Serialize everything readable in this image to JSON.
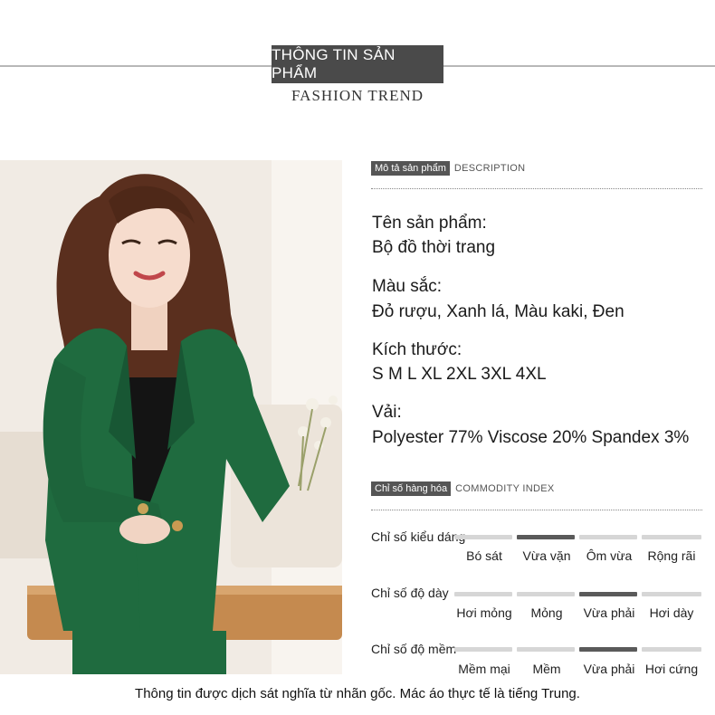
{
  "header": {
    "title": "THÔNG TIN SẢN PHẨM",
    "subtitle": "FASHION TREND"
  },
  "description": {
    "tag": "Mô tả sản phẩm",
    "tag_en": "DESCRIPTION",
    "items": [
      {
        "label": "Tên sản phẩm:",
        "value": "Bộ đồ thời trang"
      },
      {
        "label": "Màu sắc:",
        "value": "Đỏ rượu, Xanh lá, Màu kaki, Đen"
      },
      {
        "label": "Kích thước:",
        "value": "S M L XL 2XL 3XL 4XL"
      },
      {
        "label": "Vải:",
        "value": "Polyester 77% Viscose 20% Spandex 3%"
      }
    ]
  },
  "commodity_index": {
    "tag": "Chỉ số hàng hóa",
    "tag_en": "COMMODITY INDEX",
    "rows": [
      {
        "label": "Chỉ số kiểu dáng",
        "options": [
          "Bó sát",
          "Vừa vặn",
          "Ôm vừa",
          "Rộng rãi"
        ],
        "selected_index": 1
      },
      {
        "label": "Chỉ số độ dày",
        "options": [
          "Hơi mỏng",
          "Mỏng",
          "Vừa phải",
          "Hơi dày"
        ],
        "selected_index": 2
      },
      {
        "label": "Chỉ số độ mềm",
        "options": [
          "Mềm mại",
          "Mềm",
          "Vừa phải",
          "Hơi cứng"
        ],
        "selected_index": 2
      }
    ]
  },
  "footer": {
    "note": "Thông tin được dịch sát nghĩa từ nhãn gốc. Mác áo thực tế là tiếng Trung."
  },
  "colors": {
    "suit_green": "#1f6b3f",
    "tag_bg": "#555555",
    "bar_active": "#5a5a5a",
    "bar_inactive": "#d6d6d6"
  }
}
